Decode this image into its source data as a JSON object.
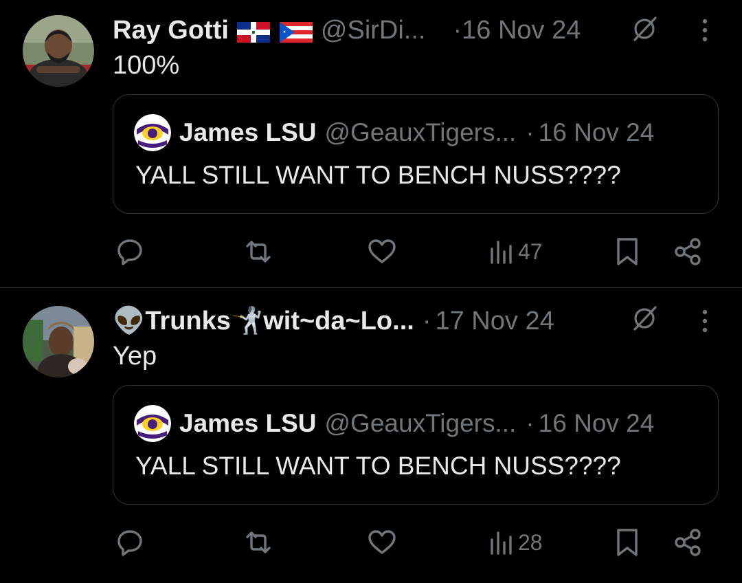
{
  "tweets": [
    {
      "display_name": "Ray Gotti",
      "handle": "@SirDi...",
      "separator": "·",
      "date": "16 Nov 24",
      "text": "100%",
      "quote": {
        "display_name": "James LSU",
        "handle": "@GeauxTigers...",
        "separator": "·",
        "date": "16 Nov 24",
        "text": "YALL STILL WANT TO BENCH NUSS????"
      },
      "views": "47"
    },
    {
      "display_name": "👽Trunks🤺wit~da~Lo...",
      "separator": "·",
      "date": "17 Nov 24",
      "text": "Yep",
      "quote": {
        "display_name": "James LSU",
        "handle": "@GeauxTigers...",
        "separator": "·",
        "date": "16 Nov 24",
        "text": "YALL STILL WANT TO BENCH NUSS????"
      },
      "views": "28"
    }
  ],
  "icons": {
    "grok": "grok-icon",
    "more": "more-icon",
    "reply": "reply-icon",
    "retweet": "retweet-icon",
    "like": "like-icon",
    "views": "views-icon",
    "bookmark": "bookmark-icon",
    "share": "share-icon",
    "flags": [
      "dominican-republic-flag-icon",
      "puerto-rico-flag-icon"
    ]
  },
  "colors": {
    "background": "#000000",
    "text": "#e7e9ea",
    "muted": "#71767b",
    "border": "#2f3336",
    "lsu_purple": "#461d7c",
    "lsu_gold": "#fdd023"
  }
}
